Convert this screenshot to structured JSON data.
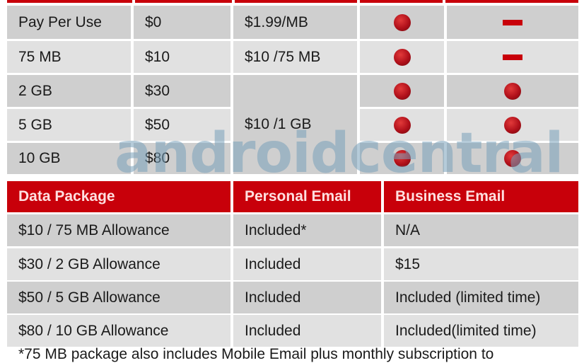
{
  "plan_table": {
    "rows": [
      {
        "plan": "Pay Per Use",
        "price": "$0",
        "overage": "$1.99/MB",
        "col4": "check",
        "col5": "dash"
      },
      {
        "plan": "75 MB",
        "price": "$10",
        "overage": "$10 /75 MB",
        "col4": "check",
        "col5": "dash"
      },
      {
        "plan": "2 GB",
        "price": "$30",
        "overage": "",
        "col4": "check",
        "col5": "check"
      },
      {
        "plan": "5 GB",
        "price": "$50",
        "overage": "$10 /1 GB",
        "col4": "check",
        "col5": "check"
      },
      {
        "plan": "10 GB",
        "price": "$80",
        "overage": "",
        "col4": "check",
        "col5": "check"
      }
    ],
    "merged_overage": "$10 /1 GB"
  },
  "email_table": {
    "headers": [
      "Data Package",
      "Personal Email",
      "Business Email"
    ],
    "rows": [
      [
        "$10 / 75 MB Allowance",
        "Included*",
        "N/A"
      ],
      [
        "$30 / 2 GB Allowance",
        "Included",
        "$15"
      ],
      [
        "$50 / 5 GB Allowance",
        "Included",
        "Included (limited time)"
      ],
      [
        "$80 / 10 GB Allowance",
        "Included",
        "Included(limited time)"
      ]
    ]
  },
  "watermark": "androidcentral",
  "footnote": "*75 MB package also includes Mobile Email plus monthly subscription to",
  "colors": {
    "header_red": "#c8000a",
    "row_dark": "#cfcfcf",
    "row_light": "#e1e1e1"
  }
}
